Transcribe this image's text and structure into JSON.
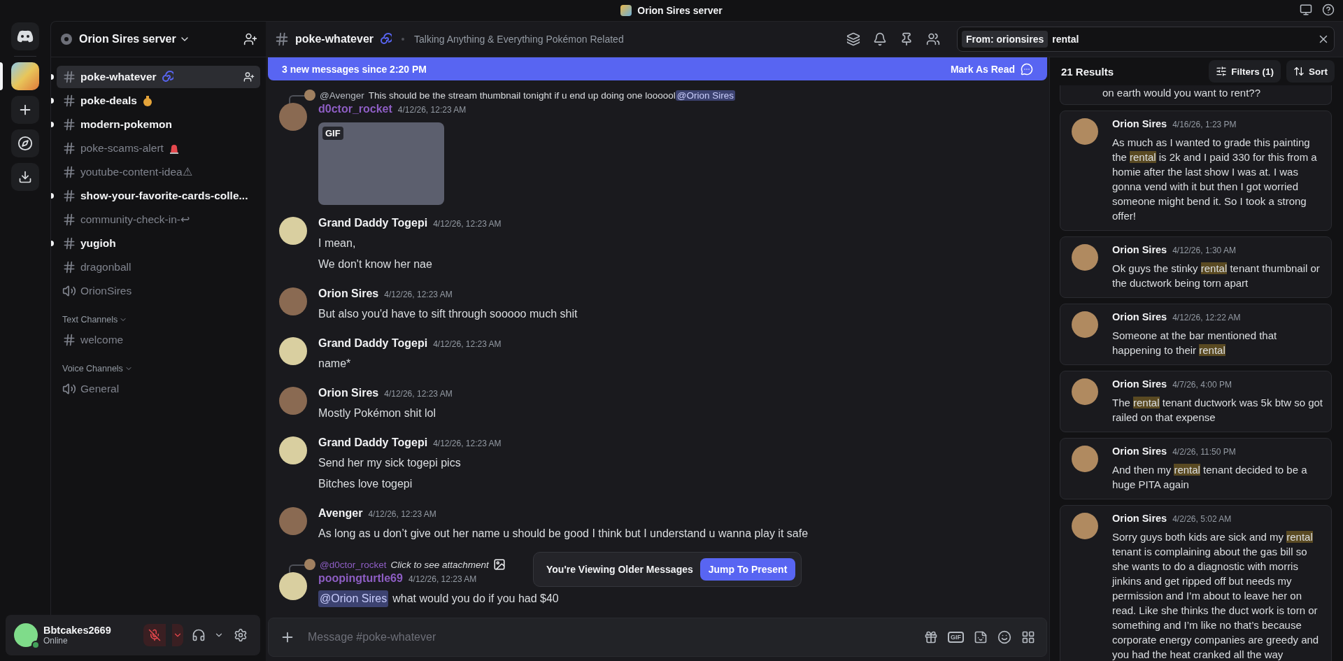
{
  "title_bar": {
    "title": "Orion Sires server"
  },
  "server_rail": {
    "items": [
      {
        "kind": "home",
        "selected": false
      },
      {
        "kind": "server",
        "selected": true
      },
      {
        "kind": "add",
        "selected": false
      },
      {
        "kind": "discover",
        "selected": false
      },
      {
        "kind": "download",
        "selected": false
      }
    ]
  },
  "sidebar": {
    "server_name": "Orion Sires server",
    "channels": [
      {
        "kind": "text",
        "name": "poke-whatever",
        "emoji": true,
        "unread": true,
        "selected": true
      },
      {
        "kind": "text",
        "name": "poke-deals",
        "emoji": true,
        "unread": true,
        "selected": false
      },
      {
        "kind": "text",
        "name": "modern-pokemon",
        "unread": true,
        "selected": false
      },
      {
        "kind": "text",
        "name": "poke-scams-alert",
        "emoji": true,
        "unread": false,
        "selected": false
      },
      {
        "kind": "text",
        "name": "youtube-content-idea⚠",
        "unread": false,
        "selected": false
      },
      {
        "kind": "text",
        "name": "show-your-favorite-cards-colle...",
        "unread": true,
        "selected": false
      },
      {
        "kind": "text",
        "name": "community-check-in-↩",
        "unread": false,
        "selected": false
      },
      {
        "kind": "text",
        "name": "yugioh",
        "unread": true,
        "selected": false
      },
      {
        "kind": "text",
        "name": "dragonball",
        "unread": false,
        "selected": false
      },
      {
        "kind": "voice",
        "name": "OrionSires",
        "unread": false,
        "selected": false
      }
    ],
    "categories": [
      {
        "name": "Text Channels",
        "expanded": true,
        "channels": [
          {
            "kind": "text",
            "name": "welcome",
            "unread": false,
            "selected": false
          }
        ]
      },
      {
        "name": "Voice Channels",
        "expanded": true,
        "channels": [
          {
            "kind": "voice",
            "name": "General",
            "unread": false,
            "selected": false
          }
        ]
      }
    ]
  },
  "user_panel": {
    "name": "Bbtcakes2669",
    "status": "Online",
    "mic_muted": true
  },
  "channel_header": {
    "name": "poke-whatever",
    "topic": "Talking Anything & Everything Pokémon Related"
  },
  "search": {
    "filter_chip": "From: orionsires",
    "query": "rental"
  },
  "new_messages_bar": {
    "text": "3 new messages since 2:20 PM",
    "action": "Mark As Read"
  },
  "messages": [
    {
      "author": "d0ctor_rocket",
      "color": "#8e5ec4",
      "time": "4/12/26, 12:23 AM",
      "reply": {
        "author": "@Avenger",
        "color": "#b5bac1",
        "parts": [
          {
            "kind": "text",
            "text": "This should be the stream thumbnail tonight if u end up doing one loooool"
          },
          {
            "kind": "mention",
            "text": "@Orion Sires"
          }
        ]
      },
      "gif": {
        "label": "GIF"
      }
    },
    {
      "author": "Grand Daddy Togepi",
      "color": "#f2f3f5",
      "time": "4/12/26, 12:23 AM",
      "lines": [
        [
          {
            "kind": "text",
            "text": "I mean,"
          }
        ],
        [
          {
            "kind": "text",
            "text": "We don't know her nae"
          }
        ]
      ]
    },
    {
      "author": "Orion Sires",
      "color": "#f2f3f5",
      "time": "4/12/26, 12:23 AM",
      "lines": [
        [
          {
            "kind": "text",
            "text": "But also you'd have to sift through sooooo much shit"
          }
        ]
      ]
    },
    {
      "author": "Grand Daddy Togepi",
      "color": "#f2f3f5",
      "time": "4/12/26, 12:23 AM",
      "lines": [
        [
          {
            "kind": "text",
            "text": "name*"
          }
        ]
      ]
    },
    {
      "author": "Orion Sires",
      "color": "#f2f3f5",
      "time": "4/12/26, 12:23 AM",
      "lines": [
        [
          {
            "kind": "text",
            "text": "Mostly Pokémon shit lol"
          }
        ]
      ]
    },
    {
      "author": "Grand Daddy Togepi",
      "color": "#f2f3f5",
      "time": "4/12/26, 12:23 AM",
      "lines": [
        [
          {
            "kind": "text",
            "text": "Send her my sick togepi pics"
          }
        ],
        [
          {
            "kind": "text",
            "text": "Bitches love togepi"
          }
        ]
      ]
    },
    {
      "author": "Avenger",
      "color": "#f2f3f5",
      "time": "4/12/26, 12:23 AM",
      "lines": [
        [
          {
            "kind": "text",
            "text": "As long as u don’t give out her name u should be good I think but I understand u wanna play it safe"
          }
        ]
      ]
    },
    {
      "author": "poopingturtle69",
      "color": "#8e5ec4",
      "time": "4/12/26, 12:23 AM",
      "reply": {
        "author": "@d0ctor_rocket",
        "color": "#8e5ec4",
        "parts": [
          {
            "kind": "italic",
            "text": "Click to see attachment"
          }
        ],
        "attachment": true
      },
      "lines": [
        [
          {
            "kind": "mention",
            "text": "@Orion Sires"
          },
          {
            "kind": "text",
            "text": "what would you do if you had $40"
          }
        ]
      ]
    }
  ],
  "older_messages_toast": {
    "text": "You're Viewing Older Messages",
    "action": "Jump To Present"
  },
  "composer": {
    "placeholder": "Message #poke-whatever",
    "gif_label": "GIF"
  },
  "results": {
    "count": "21 Results",
    "filters": "Filters (1)",
    "sort": "Sort",
    "items": [
      {
        "kind": "clipped",
        "parts": [
          {
            "text": "on earth would you want to rent??",
            "highlight": false
          }
        ]
      },
      {
        "kind": "full",
        "author": "Orion Sires",
        "time": "4/16/26, 1:23 PM",
        "parts": [
          {
            "text": "As much as I wanted to grade this painting the ",
            "highlight": false
          },
          {
            "text": "rental",
            "highlight": true
          },
          {
            "text": " is 2k and I paid 330 for this from a homie after the last show I was at. I was gonna vend with it but then I got worried someone might bend it. So I took a strong offer!",
            "highlight": false
          }
        ]
      },
      {
        "kind": "full",
        "author": "Orion Sires",
        "time": "4/12/26, 1:30 AM",
        "parts": [
          {
            "text": "Ok guys the stinky ",
            "highlight": false
          },
          {
            "text": "rental",
            "highlight": true
          },
          {
            "text": " tenant thumbnail or the ductwork being torn apart",
            "highlight": false
          }
        ]
      },
      {
        "kind": "full",
        "author": "Orion Sires",
        "time": "4/12/26, 12:22 AM",
        "parts": [
          {
            "text": "Someone at the bar mentioned that happening to their ",
            "highlight": false
          },
          {
            "text": "rental",
            "highlight": true
          }
        ]
      },
      {
        "kind": "full",
        "author": "Orion Sires",
        "time": "4/7/26, 4:00 PM",
        "parts": [
          {
            "text": "The ",
            "highlight": false
          },
          {
            "text": "rental",
            "highlight": true
          },
          {
            "text": " tenant ductwork was 5k btw so got railed on that expense",
            "highlight": false
          }
        ]
      },
      {
        "kind": "full",
        "author": "Orion Sires",
        "time": "4/2/26, 11:50 PM",
        "parts": [
          {
            "text": "And then my ",
            "highlight": false
          },
          {
            "text": "rental",
            "highlight": true
          },
          {
            "text": " tenant decided to be a huge PITA again",
            "highlight": false
          }
        ]
      },
      {
        "kind": "full",
        "author": "Orion Sires",
        "time": "4/2/26, 5:02 AM",
        "parts": [
          {
            "text": "Sorry guys both kids are sick and my ",
            "highlight": false
          },
          {
            "text": "rental",
            "highlight": true
          },
          {
            "text": " tenant is complaining about the gas bill so she wants to do a diagnostic with morris jinkins and get ripped off but needs my permission and I’m about to leave her on read. Like she thinks the duct work is torn or something and I’m like no that’s because corporate energy companies are greedy and you had the heat cranked all the way",
            "highlight": false
          }
        ]
      }
    ]
  }
}
